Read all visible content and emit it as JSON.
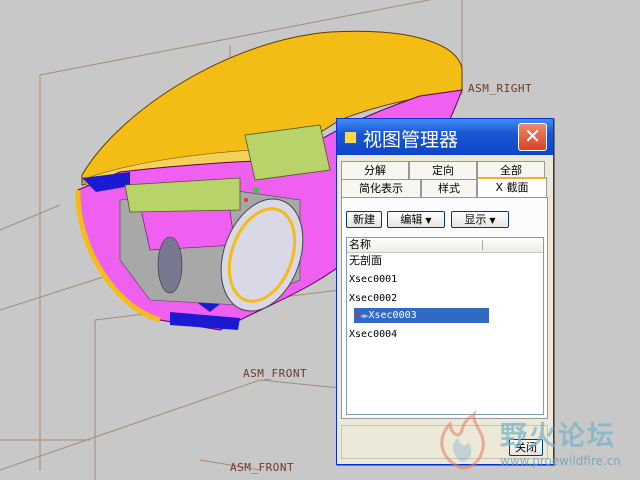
{
  "viewport": {
    "plane_labels": {
      "right": "ASM_RIGHT",
      "front_1": "ASM_FRONT",
      "front_2": "ASM_FRONT"
    },
    "colors": {
      "background": "#c8c8c8",
      "shell_yellow": "#f4bd16",
      "cut_magenta": "#f060f0",
      "hatch_blue": "#1a1ad0",
      "green_part": "#b7d36a"
    }
  },
  "dialog": {
    "title": "视图管理器",
    "tabs_row1": [
      {
        "label": "分解"
      },
      {
        "label": "定向"
      },
      {
        "label": "全部"
      }
    ],
    "tabs_row2": [
      {
        "label": "简化表示"
      },
      {
        "label": "样式"
      },
      {
        "label": "X 截面"
      }
    ],
    "active_tab": "X 截面",
    "buttons": {
      "new": "新建",
      "edit": "编辑",
      "display": "显示"
    },
    "list": {
      "column": "名称",
      "items": [
        {
          "label": "无剖面"
        },
        {
          "label": "Xsec0001"
        },
        {
          "label": "Xsec0002"
        },
        {
          "label": "Xsec0003",
          "selected": true
        },
        {
          "label": "Xsec0004"
        }
      ]
    },
    "close_label": "关闭"
  },
  "watermark": {
    "text": "野火论坛",
    "url": "www.proewildfire.cn"
  }
}
